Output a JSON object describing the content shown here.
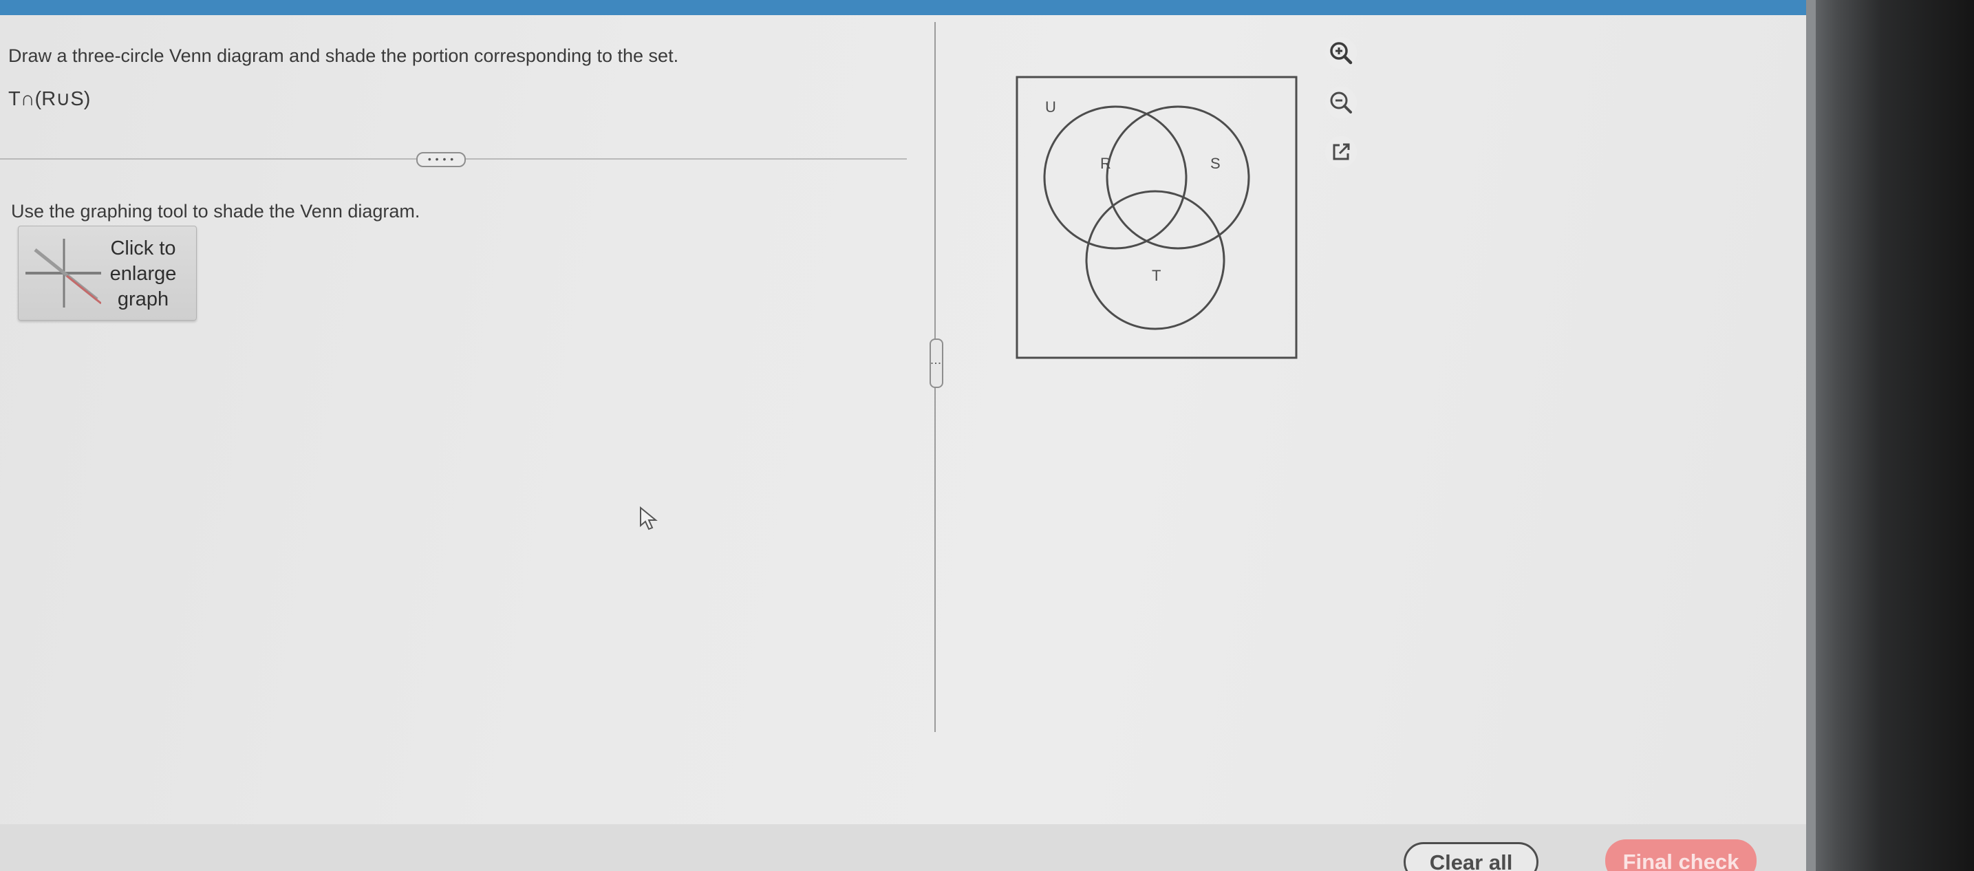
{
  "question": {
    "prompt": "Draw a three-circle Venn diagram and shade the portion corresponding to the set.",
    "set_expression": "T∩(R∪S)"
  },
  "expand_handle": "• • • •",
  "instruction": "Use the graphing tool to shade the Venn diagram.",
  "enlarge_button": {
    "line1": "Click to",
    "line2": "enlarge",
    "line3": "graph"
  },
  "venn": {
    "universe_label": "U",
    "circle_labels": [
      "R",
      "S",
      "T"
    ]
  },
  "tools": {
    "zoom_in_icon": "zoom-in-icon",
    "zoom_out_icon": "zoom-out-icon",
    "popout_icon": "external-link-icon"
  },
  "footer": {
    "clear_label": "Clear all",
    "final_label": "Final check"
  },
  "colors": {
    "topbar": "#3f88bf",
    "final_button": "#ee8e8e",
    "outline": "#4d4d4d"
  }
}
